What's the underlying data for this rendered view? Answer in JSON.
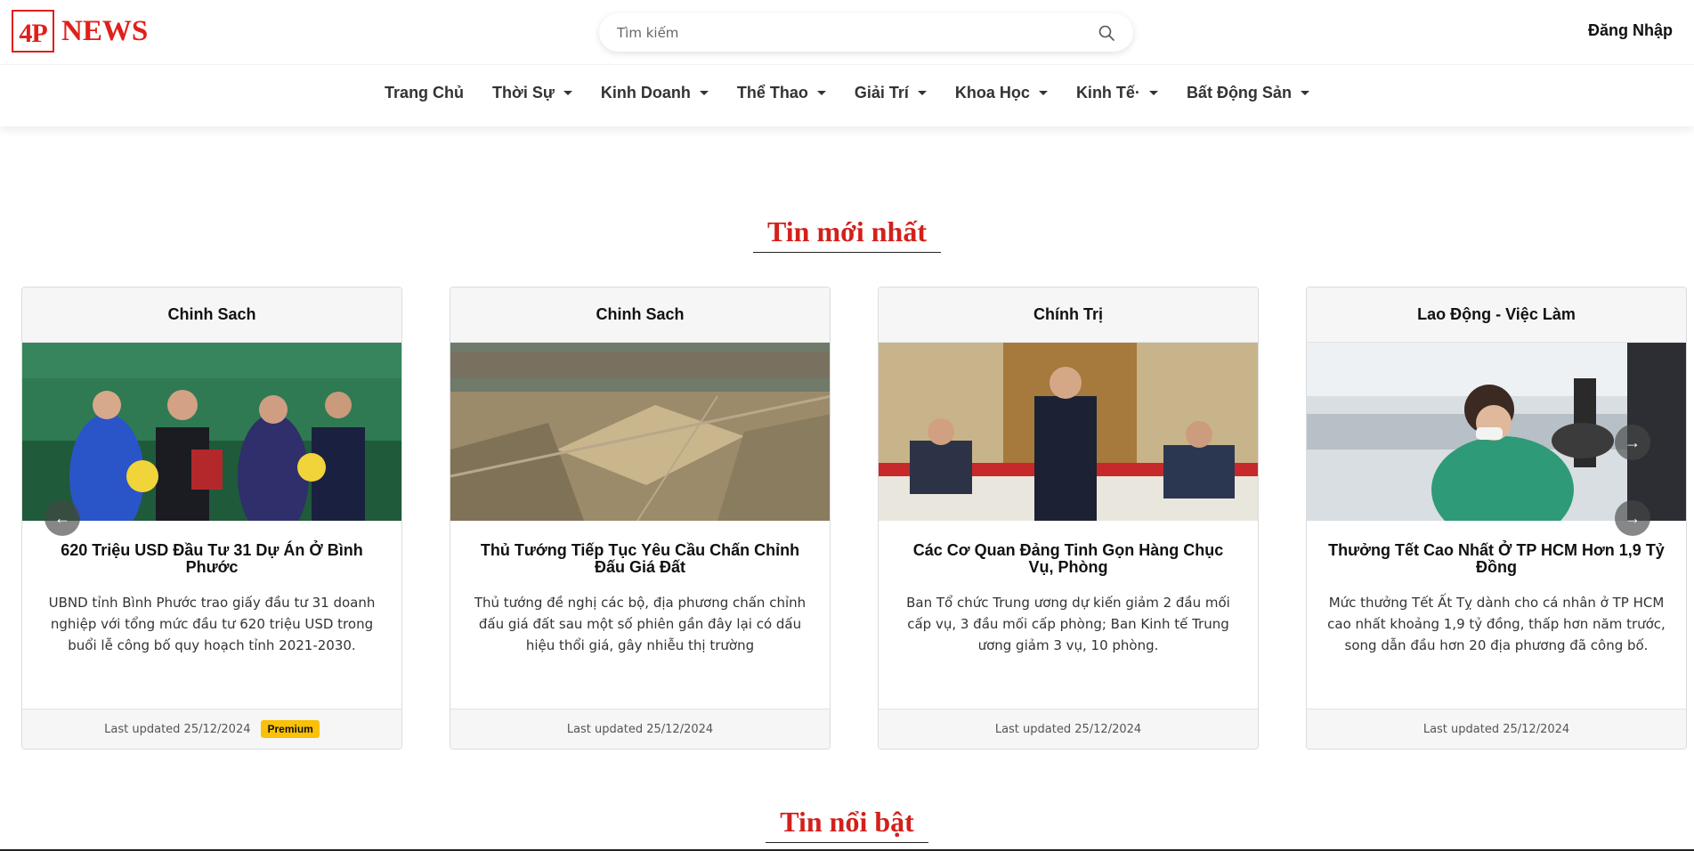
{
  "logo": {
    "mark": "4P",
    "text": "NEWS"
  },
  "search": {
    "placeholder": "Tìm kiếm"
  },
  "header": {
    "login_label": "Đăng Nhập"
  },
  "nav": {
    "items": [
      {
        "label": "Trang Chủ",
        "dropdown": false
      },
      {
        "label": "Thời Sự",
        "dropdown": true
      },
      {
        "label": "Kinh Doanh",
        "dropdown": true
      },
      {
        "label": "Thể Thao",
        "dropdown": true
      },
      {
        "label": "Giải Trí",
        "dropdown": true
      },
      {
        "label": "Khoa Học",
        "dropdown": true
      },
      {
        "label": "Kinh Tế·",
        "dropdown": true
      },
      {
        "label": "Bất Động Sản",
        "dropdown": true
      }
    ]
  },
  "sections": {
    "latest_title": "Tin mới nhất",
    "featured_title": "Tin nổi bật"
  },
  "cards": [
    {
      "category": "Chinh Sach",
      "image_name": "award-ceremony-photo",
      "title": "620 Triệu USD Đầu Tư 31 Dự Án Ở Bình Phước",
      "description": "UBND tỉnh Bình Phước trao giấy đầu tư 31 doanh nghiệp với tổng mức đầu tư 620 triệu USD trong buổi lễ công bố quy hoạch tỉnh 2021-2030.",
      "updated": "Last updated 25/12/2024",
      "badge": "Premium"
    },
    {
      "category": "Chinh Sach",
      "image_name": "aerial-land-photo",
      "title": "Thủ Tướng Tiếp Tục Yêu Cầu Chấn Chỉnh Đấu Giá Đất",
      "description": "Thủ tướng đề nghị các bộ, địa phương chấn chỉnh đấu giá đất sau một số phiên gần đây lại có dấu hiệu thổi giá, gây nhiễu thị trường",
      "updated": "Last updated 25/12/2024",
      "badge": ""
    },
    {
      "category": "Chính Trị",
      "image_name": "meeting-room-photo",
      "title": "Các Cơ Quan Đảng Tinh Gọn Hàng Chục Vụ, Phòng",
      "description": "Ban Tổ chức Trung ương dự kiến giảm 2 đầu mối cấp vụ, 3 đầu mối cấp phòng; Ban Kinh tế Trung ương giảm 3 vụ, 10 phòng.",
      "updated": "Last updated 25/12/2024",
      "badge": ""
    },
    {
      "category": "Lao Động - Việc Làm",
      "image_name": "factory-worker-photo",
      "title": "Thưởng Tết Cao Nhất Ở TP HCM Hơn 1,9 Tỷ Đồng",
      "description": "Mức thưởng Tết Ất Tỵ dành cho cá nhân ở TP HCM cao nhất khoảng 1,9 tỷ đồng, thấp hơn năm trước, song dẫn đầu hơn 20 địa phương đã công bố.",
      "updated": "Last updated 25/12/2024",
      "badge": ""
    }
  ],
  "carousel": {
    "prev_glyph": "←",
    "next_glyph": "→"
  }
}
